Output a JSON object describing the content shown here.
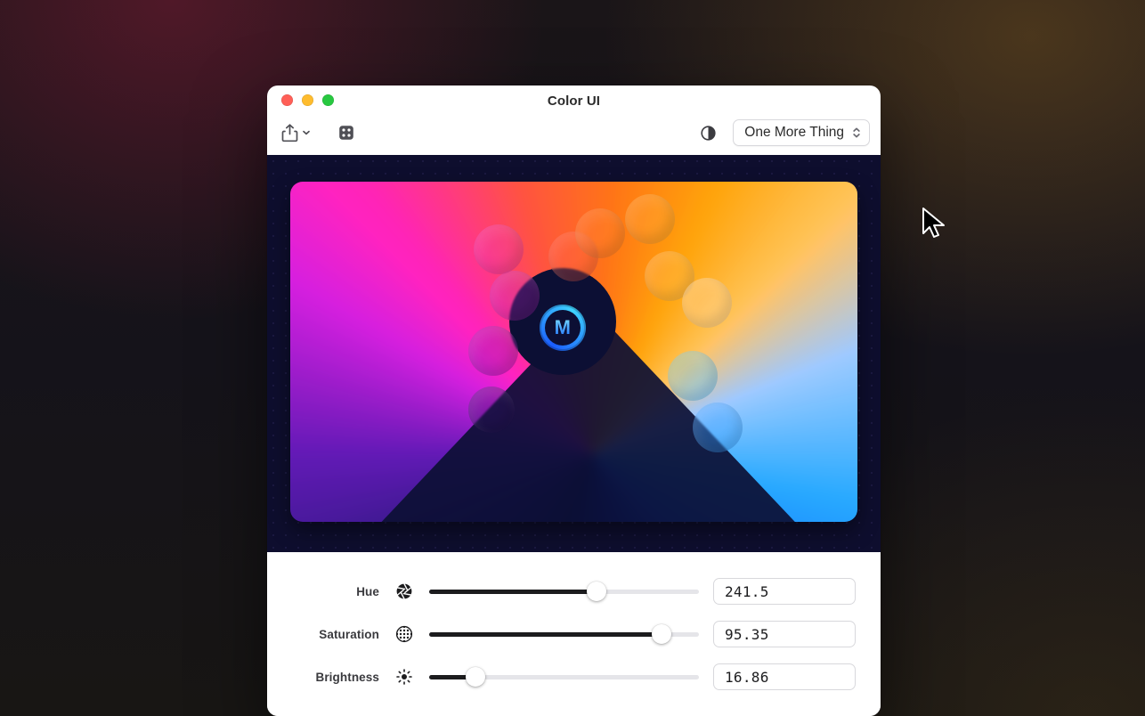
{
  "window": {
    "title": "Color UI"
  },
  "toolbar": {
    "share_icon": "share-icon",
    "dice_icon": "dice-icon",
    "contrast_icon": "contrast-icon",
    "preset_selected": "One More Thing"
  },
  "preview": {
    "logo_letter": "M"
  },
  "controls": {
    "hue": {
      "label": "Hue",
      "value": "241.5",
      "min": 0,
      "max": 360,
      "pct": 62
    },
    "saturation": {
      "label": "Saturation",
      "value": "95.35",
      "min": 0,
      "max": 100,
      "pct": 86
    },
    "brightness": {
      "label": "Brightness",
      "value": "16.86",
      "min": 0,
      "max": 100,
      "pct": 17
    }
  },
  "colors": {
    "window_bg": "#ffffff",
    "dark_bg": "#0e0e2e",
    "accent_blue": "#1a6cff"
  }
}
